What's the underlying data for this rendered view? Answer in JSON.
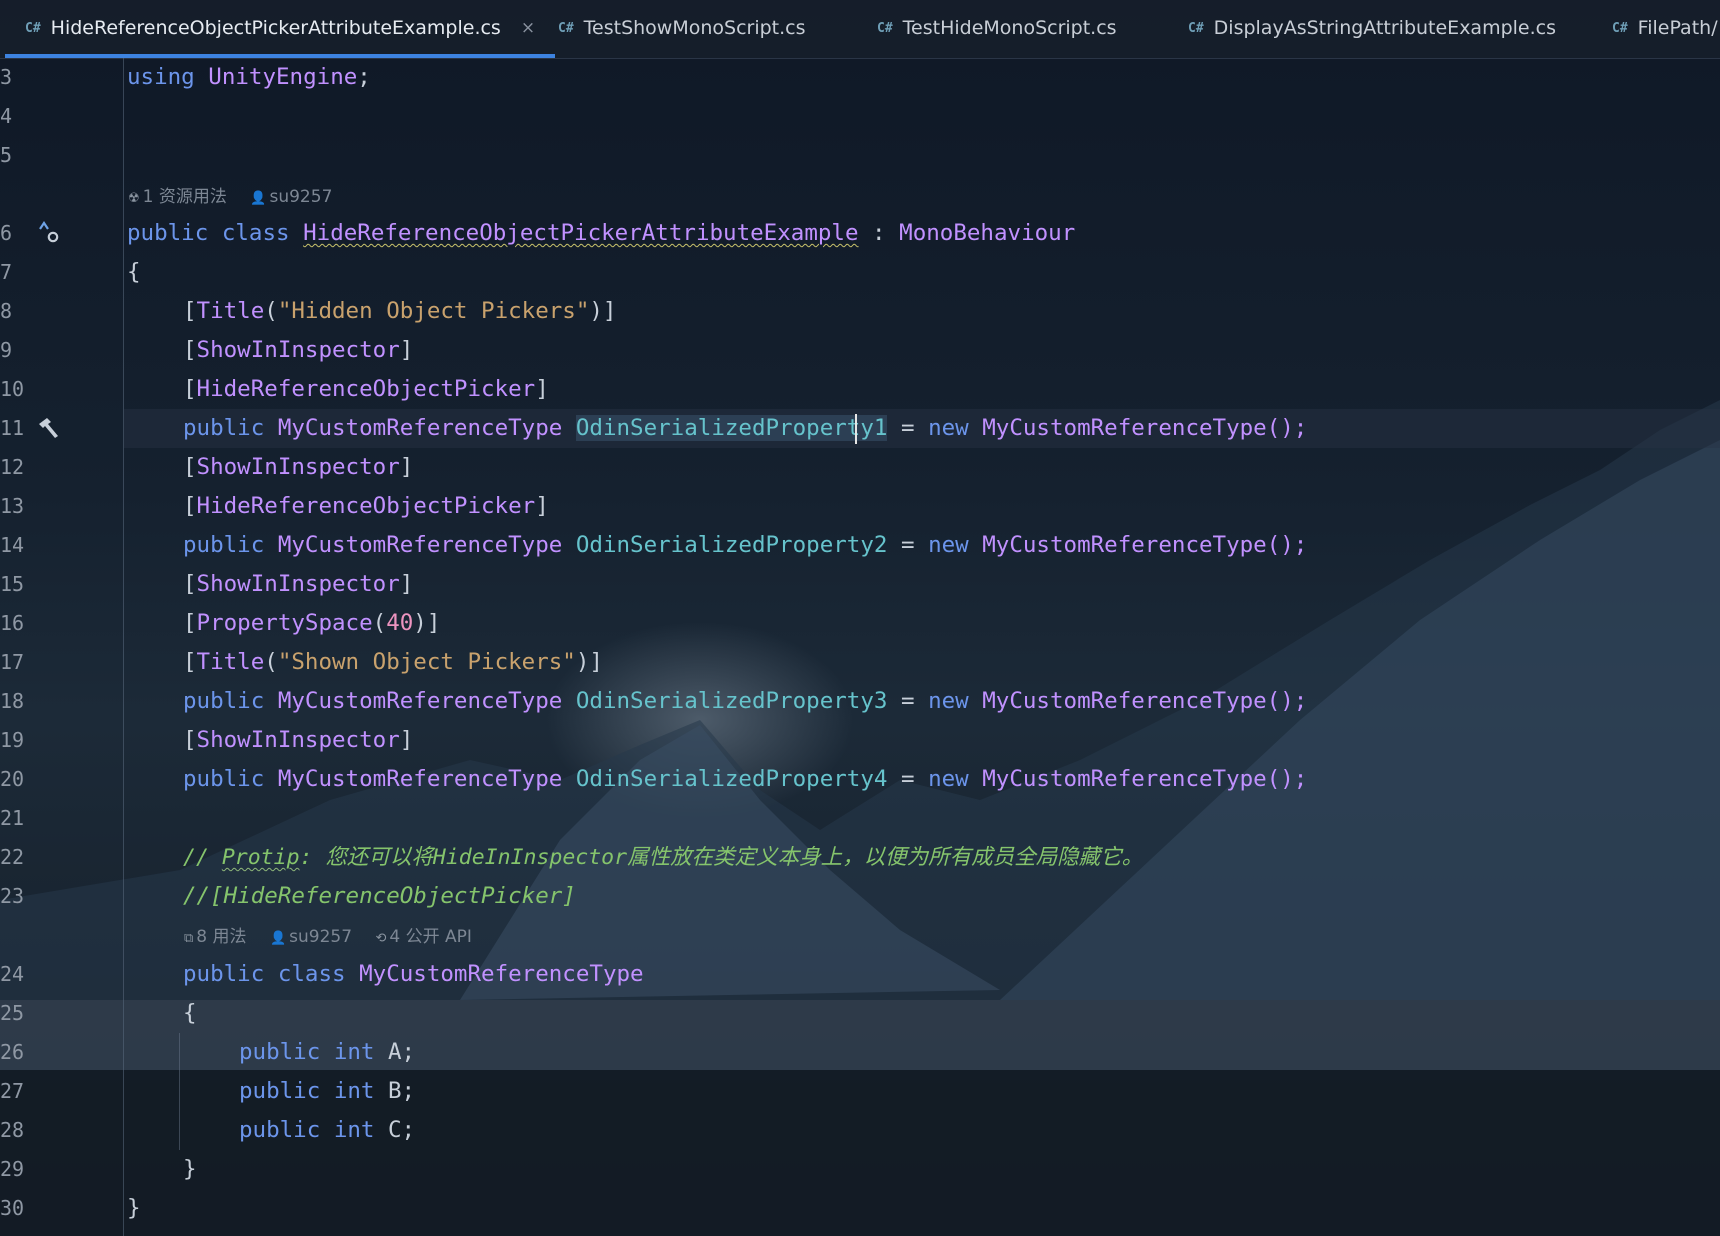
{
  "tabs": [
    {
      "badge": "C#",
      "label": "HideReferenceObjectPickerAttributeExample.cs",
      "close": "×"
    },
    {
      "badge": "C#",
      "label": "TestShowMonoScript.cs"
    },
    {
      "badge": "C#",
      "label": "TestHideMonoScript.cs"
    },
    {
      "badge": "C#",
      "label": "DisplayAsStringAttributeExample.cs"
    },
    {
      "badge": "C#",
      "label": "FilePath/"
    }
  ],
  "line_numbers": [
    "3",
    "4",
    "5",
    "6",
    "7",
    "8",
    "9",
    "10",
    "11",
    "12",
    "13",
    "14",
    "15",
    "16",
    "17",
    "18",
    "19",
    "20",
    "21",
    "22",
    "23",
    "24",
    "25",
    "26",
    "27",
    "28",
    "29",
    "30"
  ],
  "hints": {
    "class_usages": "1 资源用法",
    "class_author": "su9257",
    "nested_usages": "8 用法",
    "nested_author": "su9257",
    "nested_api": "4 公开 API"
  },
  "code": {
    "l3": {
      "kw": "using",
      "ns": "UnityEngine",
      "end": ";"
    },
    "l6": {
      "kw1": "public",
      "kw2": "class",
      "name": "HideReferenceObjectPickerAttributeExample",
      "colon": " : ",
      "base": "MonoBehaviour"
    },
    "open": "{",
    "close": "}",
    "attr_title": "Title",
    "str_hidden": "\"Hidden Object Pickers\"",
    "str_shown": "\"Shown Object Pickers\"",
    "attr_show": "ShowInInspector",
    "attr_hide": "HideReferenceObjectPicker",
    "attr_space": "PropertySpace",
    "num_40": "40",
    "kw_public": "public",
    "kw_new": "new",
    "kw_class": "class",
    "kw_int": "int",
    "type": "MyCustomReferenceType",
    "prop1": "OdinSerializedProperty1",
    "prop2": "OdinSerializedProperty2",
    "prop3": "OdinSerializedProperty3",
    "prop4": "OdinSerializedProperty4",
    "ctor": "MyCustomReferenceType();",
    "eq": " = ",
    "comment1_prefix": "// ",
    "comment1_word": "Protip",
    "comment1_rest": ": 您还可以将HideInInspector属性放在类定义本身上，以便为所有成员全局隐藏它。",
    "comment2": "//[HideReferenceObjectPicker]",
    "field_a": "A;",
    "field_b": "B;",
    "field_c": "C;"
  }
}
